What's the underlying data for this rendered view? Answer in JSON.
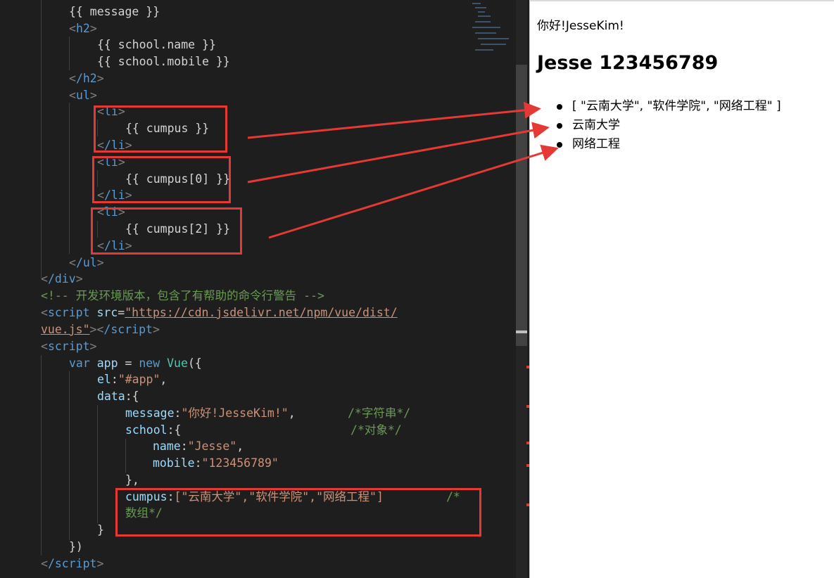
{
  "code": {
    "message_tpl": "{{ message }}",
    "h2_open": "h2",
    "school_name_tpl": "{{ school.name }}",
    "school_mobile_tpl": "{{ school.mobile }}",
    "h2_close": "/h2",
    "ul_open": "ul",
    "li": "li",
    "li_close": "/li",
    "cumpus_tpl": "{{ cumpus }}",
    "cumpus0_tpl": "{{ cumpus[0] }}",
    "cumpus2_tpl": "{{ cumpus[2] }}",
    "ul_close": "/ul",
    "div_close": "/div",
    "comment": "<!-- 开发环境版本，包含了有帮助的命令行警告 -->",
    "script_tag": "script",
    "src_attr": "src",
    "src_url_1": "\"https://cdn.jsdelivr.net/npm/vue/dist/",
    "src_url_2": "vue.js\"",
    "script_close": "/script",
    "var_kw": "var",
    "app_var": "app",
    "eq": " = ",
    "new_kw": "new",
    "vue_cls": "Vue",
    "paren_open": "({",
    "el_key": "el",
    "el_val": "\"#app\"",
    "data_key": "data",
    "message_key": "message",
    "message_val": "\"你好!JesseKim!\"",
    "comment_string": "/*字符串*/",
    "school_key": "school",
    "comment_object": "/*对象*/",
    "name_key": "name",
    "name_val": "\"Jesse\"",
    "mobile_key": "mobile",
    "mobile_val": "\"123456789\"",
    "close_obj": "},",
    "cumpus_key": "cumpus",
    "cumpus_val": "[\"云南大学\",\"软件学院\",\"网络工程\"]",
    "comment_array_1": "/*",
    "comment_array_2": "数组*/",
    "close_brace": "}",
    "close_call": "})"
  },
  "browser": {
    "message": "你好!JesseKim!",
    "heading": "Jesse 123456789",
    "list": [
      "[ \"云南大学\", \"软件学院\", \"网络工程\" ]",
      "云南大学",
      "网络工程"
    ]
  },
  "colors": {
    "highlight": "#e53935",
    "editor_bg": "#1e1e1e"
  }
}
